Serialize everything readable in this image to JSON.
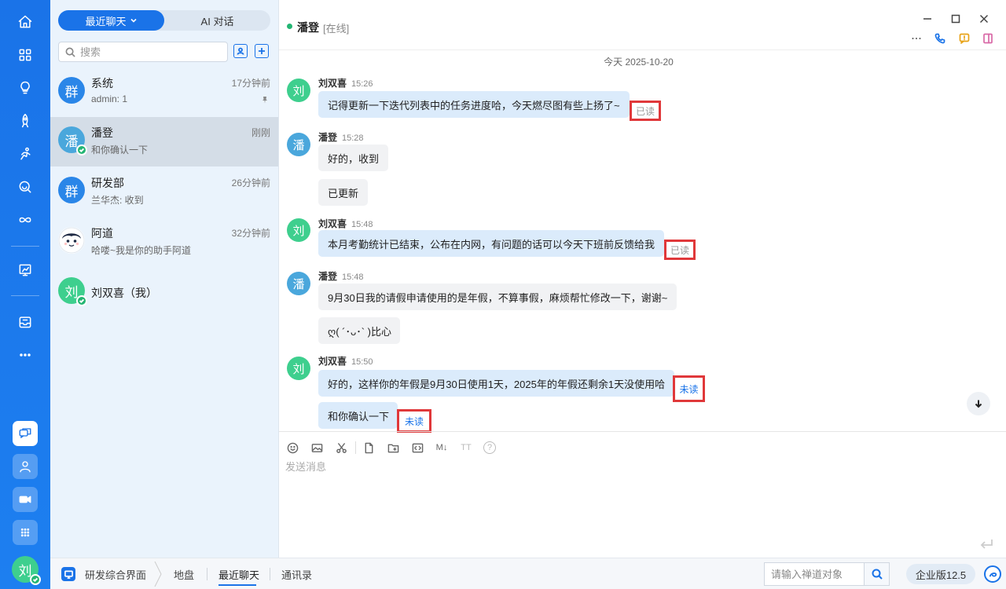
{
  "tabs": {
    "recent": "最近聊天",
    "ai": "AI 对话"
  },
  "search": {
    "placeholder": "搜索"
  },
  "conversations": [
    {
      "avatar": "群",
      "name": "系统",
      "preview": "admin: 1",
      "time": "17分钟前",
      "pinned": true,
      "color": "#2a86e8"
    },
    {
      "avatar": "潘",
      "name": "潘登",
      "preview": "和你确认一下",
      "time": "刚刚",
      "online": true,
      "color": "#4aa7dc"
    },
    {
      "avatar": "群",
      "name": "研发部",
      "preview": "兰华杰: 收到",
      "time": "26分钟前",
      "color": "#2a86e8"
    },
    {
      "avatar": "",
      "name": "阿道",
      "preview": "哈喽~我是你的助手阿道",
      "time": "32分钟前"
    },
    {
      "avatar": "刘",
      "name": "刘双喜（我）",
      "preview": "",
      "time": "",
      "online": true,
      "color": "#3ecf8e"
    }
  ],
  "chat": {
    "name": "潘登",
    "status": "[在线]",
    "date": "今天 2025-10-20",
    "messages": [
      {
        "sender": "刘双喜",
        "time": "15:26",
        "avatar": "刘",
        "text": "记得更新一下迭代列表中的任务进度哈，今天燃尽图有些上扬了~",
        "receipt": "已读"
      },
      {
        "sender": "潘登",
        "time": "15:28",
        "avatar": "潘",
        "text": "好的，收到"
      },
      {
        "text": "已更新"
      },
      {
        "sender": "刘双喜",
        "time": "15:48",
        "avatar": "刘",
        "text": "本月考勤统计已结束，公布在内网，有问题的话可以今天下班前反馈给我",
        "receipt": "已读"
      },
      {
        "sender": "潘登",
        "time": "15:48",
        "avatar": "潘",
        "text": "9月30日我的请假申请使用的是年假，不算事假，麻烦帮忙修改一下，谢谢~"
      },
      {
        "text": "ღ( ´･ᴗ･` )比心"
      },
      {
        "sender": "刘双喜",
        "time": "15:50",
        "avatar": "刘",
        "text": "好的，这样你的年假是9月30日使用1天，2025年的年假还剩余1天没使用哈",
        "receipt": "未读"
      },
      {
        "text": "和你确认一下",
        "receipt": "未读"
      }
    ]
  },
  "composer": {
    "placeholder": "发送消息",
    "markdown_label": "M↓",
    "font_label": "TT",
    "help_label": "?"
  },
  "rail": {
    "avatar": "刘"
  },
  "bottom": {
    "app": "研发综合界面",
    "crumbs": [
      "地盘",
      "最近聊天",
      "通讯录"
    ],
    "channel_placeholder": "请输入禅道对象",
    "version": "企业版12.5"
  },
  "colors": {
    "primary": "#1a73e8",
    "online": "#23b573",
    "highlight": "#e0383a",
    "my_avatar": "#3ecf8e",
    "their_avatar": "#4aa7dc"
  }
}
